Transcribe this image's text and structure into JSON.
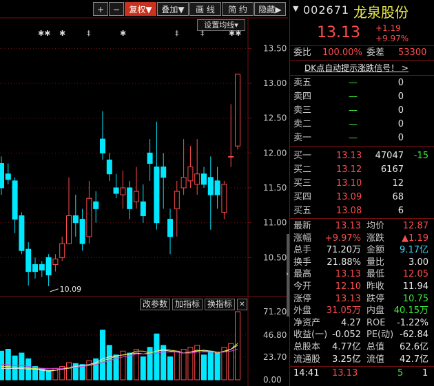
{
  "toolbar": {
    "plus": "+",
    "minus": "−",
    "fuquan": "复权▼",
    "diejia": "叠加▼",
    "huaxian": "画 线",
    "jianyue": "简 约",
    "yincang": "隐藏▶"
  },
  "ma_setting": "设置均线▾",
  "markers": [
    "✱✱",
    "✱",
    "‡",
    "✱",
    "‡",
    "‡",
    "✱✱"
  ],
  "price_axis": [
    "13.50",
    "13.00",
    "12.50",
    "12.00",
    "11.50",
    "11.00",
    "10.50"
  ],
  "vol_axis": [
    "71.20",
    "46.80",
    "23.70",
    "0.00"
  ],
  "low_label": "10.09",
  "sub_buttons": {
    "gaicanshu": "改参数",
    "jiazhibiao": "加指标",
    "huanzhibiao": "换指标",
    "close": "✕"
  },
  "chart_data": {
    "type": "candlestick",
    "ylim": [
      10.0,
      13.75
    ],
    "candles": [
      {
        "o": 11.85,
        "h": 11.95,
        "l": 11.4,
        "c": 11.5
      },
      {
        "o": 11.7,
        "h": 11.85,
        "l": 11.55,
        "c": 11.62
      },
      {
        "o": 11.6,
        "h": 11.65,
        "l": 10.85,
        "c": 11.05
      },
      {
        "o": 11.1,
        "h": 11.15,
        "l": 10.55,
        "c": 10.6
      },
      {
        "o": 10.62,
        "h": 10.72,
        "l": 10.1,
        "c": 10.3
      },
      {
        "o": 10.4,
        "h": 10.5,
        "l": 10.2,
        "c": 10.3
      },
      {
        "o": 10.4,
        "h": 10.45,
        "l": 10.22,
        "c": 10.32
      },
      {
        "o": 10.5,
        "h": 10.55,
        "l": 10.09,
        "c": 10.25
      },
      {
        "o": 10.4,
        "h": 10.55,
        "l": 10.3,
        "c": 10.48
      },
      {
        "o": 10.5,
        "h": 10.8,
        "l": 10.45,
        "c": 10.7
      },
      {
        "o": 10.7,
        "h": 11.65,
        "l": 10.7,
        "c": 11.1
      },
      {
        "o": 11.1,
        "h": 11.4,
        "l": 10.8,
        "c": 11.0
      },
      {
        "o": 11.05,
        "h": 11.2,
        "l": 10.6,
        "c": 10.7
      },
      {
        "o": 10.8,
        "h": 11.6,
        "l": 10.7,
        "c": 11.35
      },
      {
        "o": 11.3,
        "h": 11.45,
        "l": 11.0,
        "c": 11.2
      },
      {
        "o": 12.2,
        "h": 12.6,
        "l": 11.9,
        "c": 12.0
      },
      {
        "o": 11.9,
        "h": 12.0,
        "l": 11.6,
        "c": 11.7
      },
      {
        "o": 11.5,
        "h": 11.7,
        "l": 11.35,
        "c": 11.42
      },
      {
        "o": 11.4,
        "h": 11.75,
        "l": 11.2,
        "c": 11.5
      },
      {
        "o": 11.5,
        "h": 11.6,
        "l": 11.05,
        "c": 11.2
      },
      {
        "o": 11.3,
        "h": 11.8,
        "l": 11.2,
        "c": 11.45
      },
      {
        "o": 11.3,
        "h": 11.55,
        "l": 11.0,
        "c": 11.1
      },
      {
        "o": 12.0,
        "h": 12.2,
        "l": 11.6,
        "c": 11.85
      },
      {
        "o": 11.8,
        "h": 12.45,
        "l": 10.9,
        "c": 11.0
      },
      {
        "o": 11.8,
        "h": 12.0,
        "l": 11.2,
        "c": 11.65
      },
      {
        "o": 11.05,
        "h": 11.2,
        "l": 10.55,
        "c": 10.8
      },
      {
        "o": 11.2,
        "h": 11.6,
        "l": 10.8,
        "c": 11.45
      },
      {
        "o": 11.5,
        "h": 12.2,
        "l": 11.4,
        "c": 11.65
      },
      {
        "o": 11.6,
        "h": 12.1,
        "l": 11.5,
        "c": 11.8
      },
      {
        "o": 11.55,
        "h": 12.2,
        "l": 11.4,
        "c": 11.7
      },
      {
        "o": 11.7,
        "h": 11.8,
        "l": 11.5,
        "c": 11.55
      },
      {
        "o": 11.65,
        "h": 11.95,
        "l": 10.9,
        "c": 11.4
      },
      {
        "o": 11.6,
        "h": 11.8,
        "l": 11.2,
        "c": 11.4
      },
      {
        "o": 11.15,
        "h": 11.6,
        "l": 11.05,
        "c": 11.55
      },
      {
        "o": 11.94,
        "h": 12.7,
        "l": 11.8,
        "c": 11.95
      },
      {
        "o": 12.1,
        "h": 13.13,
        "l": 12.05,
        "c": 13.13
      }
    ],
    "vol_ylim": [
      0,
      71.2
    ],
    "volumes": [
      30,
      32,
      25,
      28,
      22,
      14,
      12,
      10,
      12,
      14,
      18,
      17,
      16,
      20,
      22,
      52,
      36,
      26,
      30,
      28,
      32,
      24,
      34,
      48,
      36,
      24,
      30,
      32,
      34,
      36,
      26,
      30,
      28,
      34,
      38,
      71.2
    ],
    "vol_lines": [
      {
        "color": "#e8e8e8",
        "values": [
          12,
          12,
          12,
          12,
          11,
          11,
          10,
          9,
          10,
          11,
          13,
          14,
          15,
          16,
          18,
          22,
          24,
          25,
          26,
          27,
          28,
          27,
          28,
          30,
          31,
          30,
          29,
          28,
          29,
          30,
          31,
          30,
          29,
          29,
          32,
          36
        ]
      },
      {
        "color": "#e8e84a",
        "values": [
          14,
          14,
          13,
          13,
          12,
          12,
          11,
          10,
          10,
          11,
          12,
          13,
          14,
          15,
          17,
          20,
          22,
          25,
          26,
          27,
          30,
          30,
          28,
          30,
          32,
          31,
          30,
          28,
          29,
          31,
          30,
          30,
          28,
          30,
          32,
          38
        ]
      },
      {
        "color": "#e040e0",
        "values": [
          16,
          16,
          15,
          15,
          14,
          13,
          12,
          12,
          12,
          12,
          13,
          13,
          14,
          15,
          16,
          18,
          20,
          22,
          24,
          25,
          27,
          27,
          27,
          28,
          29,
          29,
          29,
          28,
          28,
          29,
          29,
          29,
          29,
          29,
          30,
          32
        ]
      }
    ]
  },
  "quote": {
    "code": "002671",
    "name": "龙泉股份",
    "price": "13.13",
    "change": "+1.19",
    "change_pct": "+9.97%",
    "weibi_label": "委比",
    "weibi": "100.00%",
    "weicha_label": "委差",
    "weicha": "53300",
    "signal": "DK点自动提示涨跌信号！ >",
    "asks": [
      {
        "label": "卖五",
        "price": "—",
        "vol": "0"
      },
      {
        "label": "卖四",
        "price": "—",
        "vol": "0"
      },
      {
        "label": "卖三",
        "price": "—",
        "vol": "0"
      },
      {
        "label": "卖二",
        "price": "—",
        "vol": "0"
      },
      {
        "label": "卖一",
        "price": "—",
        "vol": "0"
      }
    ],
    "bids": [
      {
        "label": "买一",
        "price": "13.13",
        "vol": "47047",
        "extra": "-15"
      },
      {
        "label": "买二",
        "price": "13.12",
        "vol": "6167",
        "extra": ""
      },
      {
        "label": "买三",
        "price": "13.10",
        "vol": "12",
        "extra": ""
      },
      {
        "label": "买四",
        "price": "13.09",
        "vol": "68",
        "extra": ""
      },
      {
        "label": "买五",
        "price": "13.08",
        "vol": "6",
        "extra": ""
      }
    ],
    "stats": [
      {
        "l1": "最新",
        "v1": "13.13",
        "c1": "red",
        "l2": "均价",
        "v2": "12.87",
        "c2": "red"
      },
      {
        "l1": "涨幅",
        "v1": "+9.97%",
        "c1": "red",
        "l2": "涨跌",
        "v2": "▲1.19",
        "c2": "red"
      },
      {
        "l1": "总手",
        "v1": "71.20万",
        "c1": "white",
        "l2": "金额",
        "v2": "9.17亿",
        "c2": "cyan"
      },
      {
        "l1": "换手",
        "v1": "21.88%",
        "c1": "white",
        "l2": "量比",
        "v2": "3.00",
        "c2": "white"
      },
      {
        "l1": "最高",
        "v1": "13.13",
        "c1": "red",
        "l2": "最低",
        "v2": "12.05",
        "c2": "red"
      },
      {
        "l1": "今开",
        "v1": "12.10",
        "c1": "red",
        "l2": "昨收",
        "v2": "11.94",
        "c2": "white"
      },
      {
        "l1": "涨停",
        "v1": "13.13",
        "c1": "red",
        "l2": "跌停",
        "v2": "10.75",
        "c2": "green"
      },
      {
        "l1": "外盘",
        "v1": "31.05万",
        "c1": "red",
        "l2": "内盘",
        "v2": "40.15万",
        "c2": "green"
      },
      {
        "l1": "净资产",
        "v1": "4.27",
        "c1": "white",
        "l2": "ROE",
        "v2": "-1.22%",
        "c2": "white"
      },
      {
        "l1": "收益(一)",
        "v1": "-0.052",
        "c1": "white",
        "l2": "PE(动)",
        "v2": "-62.84",
        "c2": "white"
      },
      {
        "l1": "总股本",
        "v1": "4.77亿",
        "c1": "white",
        "l2": "总值",
        "v2": "62.6亿",
        "c2": "white"
      },
      {
        "l1": "流通股",
        "v1": "3.25亿",
        "c1": "white",
        "l2": "流值",
        "v2": "42.7亿",
        "c2": "white"
      }
    ],
    "tick": {
      "time": "14:41",
      "price": "13.13",
      "vol": "5",
      "n": "1"
    }
  },
  "colors": {
    "up": "#ff4c4c",
    "down": "#00e8ff",
    "grid": "#7a1010",
    "bg": "#000000"
  }
}
